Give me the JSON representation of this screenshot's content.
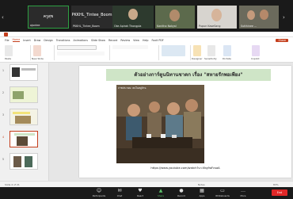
{
  "gallery": {
    "participants": [
      {
        "name": "ajantee"
      },
      {
        "name": "ครูสุข",
        "big": "ครูสุข"
      },
      {
        "name": "PKKHL_Tintee_Boom",
        "big": "PKKHL_Tintee_Boom"
      },
      {
        "name": "Oke Apirak Thongpla"
      },
      {
        "name": "Kanitha Nakyal"
      },
      {
        "name": "Pupun KaseSang"
      },
      {
        "name": "Sutthinee ..."
      }
    ]
  },
  "ppt": {
    "tabs": [
      "File",
      "Home",
      "Insert",
      "Draw",
      "Design",
      "Transitions",
      "Animations",
      "Slide Show",
      "Record",
      "Review",
      "View",
      "Help",
      "Foxit PDF"
    ],
    "active_tab": "Home",
    "share_label": "Share",
    "ribbon": {
      "paste": "Paste",
      "new_slide": "New Slide",
      "designer": "Designer",
      "sensitivity": "Sensitivity",
      "dictate": "Dictate",
      "copilot": "Copilot"
    },
    "thumbnails": [
      "1",
      "2",
      "3",
      "4",
      "5"
    ],
    "slide": {
      "title": "ตัวอย่างการ์ตูนนิทานชาดก เรื่อง \"สหายรักพอเพียง\"",
      "caption": "ภาพประกอบ: คนในหมู่บ้าน",
      "link": "https://www.youtube.com/watch?v=Xhg9oFcsaA"
    },
    "status": {
      "slide_info": "Slide 4 of 21",
      "notes": "Notes",
      "zoom": "83%"
    }
  },
  "zoom_controls": {
    "items": [
      "Participants",
      "Chat",
      "React",
      "Share",
      "Record",
      "Apps",
      "Whiteboards",
      "More"
    ],
    "end_label": "End"
  }
}
